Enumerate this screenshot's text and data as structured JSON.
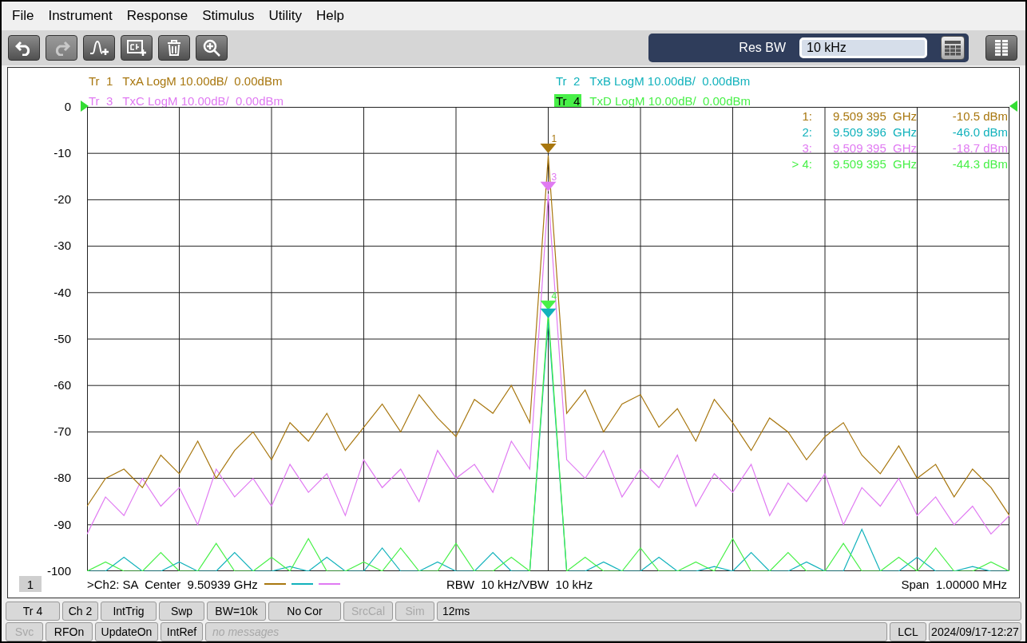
{
  "menu": [
    "File",
    "Instrument",
    "Response",
    "Stimulus",
    "Utility",
    "Help"
  ],
  "toolbar": [
    {
      "kind": "undo",
      "disabled": false
    },
    {
      "kind": "redo",
      "disabled": true
    },
    {
      "kind": "add-trace",
      "disabled": false
    },
    {
      "kind": "add-channel",
      "disabled": false
    },
    {
      "kind": "delete",
      "disabled": false
    },
    {
      "kind": "zoom",
      "disabled": false
    }
  ],
  "entry": {
    "label": "Res BW",
    "value": "10 kHz"
  },
  "traces": [
    {
      "label": "Tr  1",
      "desc": "TxA LogM 10.00dB/  0.00dBm",
      "color": "#a8770f",
      "selected": false
    },
    {
      "label": "Tr  2",
      "desc": "TxB LogM 10.00dB/  0.00dBm",
      "color": "#12b2bc",
      "selected": false
    },
    {
      "label": "Tr  3",
      "desc": "TxC LogM 10.00dB/  0.00dBm",
      "color": "#e07af2",
      "selected": false
    },
    {
      "label": "Tr  4",
      "desc": "TxD LogM 10.00dB/  0.00dBm",
      "color": "#48f048",
      "selected": true
    }
  ],
  "plot": {
    "chart_data": {
      "type": "line",
      "grid": true,
      "ylim": [
        -100,
        0
      ],
      "yticks": [
        {
          "value": 0,
          "label": "0"
        },
        {
          "value": -10,
          "label": "-10"
        },
        {
          "value": -20,
          "label": "-20"
        },
        {
          "value": -30,
          "label": "-30"
        },
        {
          "value": -40,
          "label": "-40"
        },
        {
          "value": -50,
          "label": "-50"
        },
        {
          "value": -60,
          "label": "-60"
        },
        {
          "value": -70,
          "label": "-70"
        },
        {
          "value": -80,
          "label": "-80"
        },
        {
          "value": -90,
          "label": "-90"
        },
        {
          "value": -100,
          "label": "-100"
        }
      ],
      "categories": [
        null,
        null,
        null,
        null,
        null,
        null,
        null,
        null,
        null,
        null,
        null,
        null,
        null,
        null,
        null,
        null,
        null,
        null,
        null,
        null,
        null,
        null,
        null,
        null,
        null,
        null,
        null,
        null,
        null,
        null,
        null,
        null,
        null,
        null,
        null,
        null,
        null,
        null,
        null,
        null,
        null,
        null,
        null,
        null,
        null,
        null,
        null,
        null,
        null,
        null,
        null
      ],
      "series": [
        {
          "color": "#a8770f",
          "values": [
            -86,
            -80,
            -78,
            -82,
            -75,
            -79,
            -72,
            -80,
            -74,
            -70,
            -76,
            -68,
            -72,
            -66,
            -74,
            -69,
            -64,
            -70,
            -62,
            -67,
            -71,
            -63,
            -66,
            -60,
            -68,
            -10.5,
            -66,
            -61,
            -70,
            -64,
            -62,
            -69,
            -65,
            -72,
            -63,
            -68,
            -74,
            -67,
            -70,
            -76,
            -71,
            -68,
            -75,
            -79,
            -73,
            -80,
            -77,
            -84,
            -78,
            -82,
            -88
          ]
        },
        {
          "color": "#12b2bc",
          "values": [
            -100,
            -100,
            -97,
            -100,
            -100,
            -98,
            -100,
            -100,
            -96,
            -100,
            -100,
            -99,
            -100,
            -97,
            -100,
            -100,
            -95,
            -100,
            -100,
            -98,
            -100,
            -100,
            -96,
            -100,
            -100,
            -46,
            -100,
            -100,
            -98,
            -100,
            -100,
            -97,
            -100,
            -100,
            -99,
            -100,
            -96,
            -100,
            -100,
            -98,
            -100,
            -100,
            -91,
            -100,
            -100,
            -97,
            -100,
            -100,
            -99,
            -100,
            -100
          ]
        },
        {
          "color": "#e07af2",
          "values": [
            -92,
            -84,
            -88,
            -80,
            -86,
            -82,
            -90,
            -78,
            -84,
            -80,
            -86,
            -77,
            -83,
            -79,
            -88,
            -76,
            -82,
            -78,
            -85,
            -74,
            -80,
            -77,
            -83,
            -72,
            -78,
            -18.7,
            -76,
            -80,
            -74,
            -84,
            -78,
            -82,
            -75,
            -86,
            -79,
            -83,
            -77,
            -88,
            -81,
            -85,
            -79,
            -90,
            -82,
            -86,
            -80,
            -88,
            -84,
            -90,
            -86,
            -92,
            -88
          ]
        },
        {
          "color": "#48f048",
          "values": [
            -100,
            -98,
            -100,
            -100,
            -96,
            -100,
            -100,
            -94,
            -100,
            -100,
            -97,
            -100,
            -93,
            -100,
            -100,
            -98,
            -100,
            -95,
            -100,
            -100,
            -94,
            -100,
            -100,
            -97,
            -100,
            -44.3,
            -100,
            -97,
            -100,
            -100,
            -95,
            -100,
            -100,
            -98,
            -100,
            -93,
            -100,
            -100,
            -96,
            -100,
            -100,
            -94,
            -100,
            -100,
            -97,
            -100,
            -95,
            -100,
            -100,
            -98,
            -100
          ]
        }
      ]
    },
    "markers": [
      {
        "label": "1",
        "color": "#a8770f"
      },
      {
        "label": "3",
        "color": "#e07af2"
      },
      {
        "label": "4",
        "color": "#48f048"
      },
      {
        "color": "#12b2bc"
      }
    ]
  },
  "readouts": [
    {
      "label": "1:",
      "freq": "9.509 395  GHz",
      "value": "-10.5 dBm",
      "color": "#a8770f"
    },
    {
      "label": "2:",
      "freq": "9.509 396  GHz",
      "value": "-46.0 dBm",
      "color": "#12b2bc"
    },
    {
      "label": "3:",
      "freq": "9.509 395  GHz",
      "value": "-18.7 dBm",
      "color": "#e07af2"
    },
    {
      "label": "> 4:",
      "freq": "9.509 395  GHz",
      "value": "-44.3 dBm",
      "color": "#48f048"
    }
  ],
  "channel_number": "1",
  "footer": {
    "center": ">Ch2: SA  Center  9.50939 GHz",
    "bandwidth": "RBW  10 kHz/VBW  10 kHz",
    "span": "Span  1.00000 MHz"
  },
  "status_row_1": [
    {
      "label": "Tr 4",
      "disabled": false
    },
    {
      "label": "Ch 2",
      "disabled": false
    },
    {
      "label": "IntTrig",
      "disabled": false
    },
    {
      "label": "Swp",
      "disabled": false
    },
    {
      "label": "BW=10k",
      "disabled": false
    },
    {
      "label": "No Cor",
      "disabled": false
    },
    {
      "label": "SrcCal",
      "disabled": true
    },
    {
      "label": "Sim",
      "disabled": true
    }
  ],
  "sweep_time": "12ms",
  "status_row_2": [
    {
      "label": "Svc",
      "disabled": true
    },
    {
      "label": "RFOn",
      "disabled": false
    },
    {
      "label": "UpdateOn",
      "disabled": false
    },
    {
      "label": "IntRef",
      "disabled": false
    }
  ],
  "messages": {
    "placeholder": "no messages"
  },
  "remote": "LCL",
  "datetime": "2024/09/17-12:27"
}
